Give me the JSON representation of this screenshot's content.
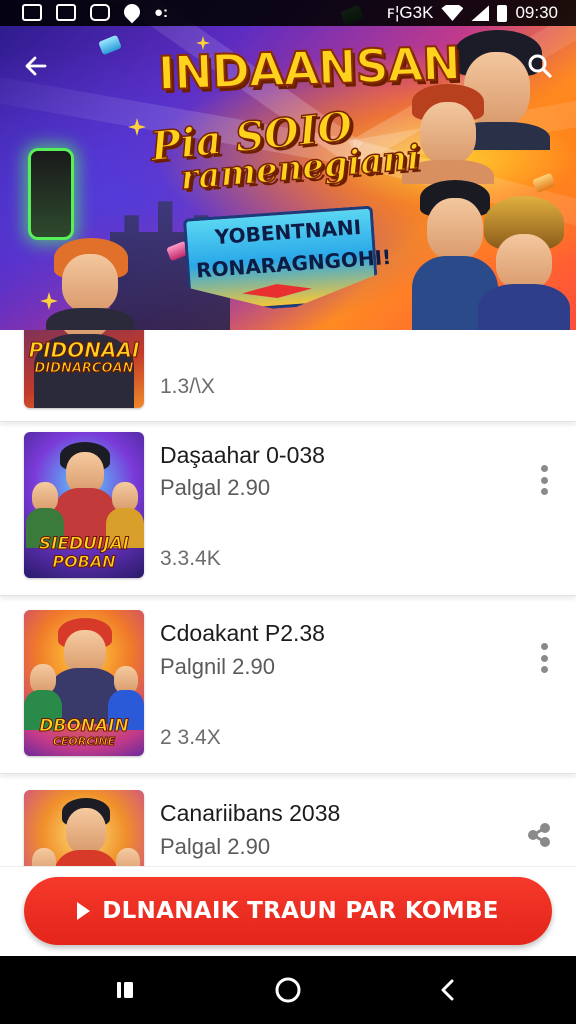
{
  "status_bar": {
    "right_text": "ꜰ¦G3K",
    "time": "09:30",
    "left_icons": [
      "image-icon",
      "gallery-icon",
      "camera-icon",
      "shield-icon",
      "more-notifications-icon"
    ]
  },
  "header": {
    "back_icon": "arrow-left-icon",
    "search_icon": "search-icon"
  },
  "banner": {
    "title_line1": "INDAANSAN",
    "title_line2": "Pia SOIO",
    "title_line3": "ramenegiani",
    "ribbon_line1": "YOBENTNANI",
    "ribbon_line2": "RONARAGNGOHI!"
  },
  "list": {
    "items": [
      {
        "title": "",
        "subtitle": "",
        "count": "1.3/\\X",
        "thumb_label_1": "PIDONAAI",
        "thumb_label_2": "DIDNARCOAN",
        "action_icon": ""
      },
      {
        "title": "Daşaahar 0-038",
        "subtitle": "Palgal 2.90",
        "count": "3.3.4K",
        "thumb_label_1": "SIEDUIJAI",
        "thumb_label_2": "POBAN",
        "action_icon": "more-vertical-icon"
      },
      {
        "title": "Cdoakant P2.38",
        "subtitle": "Palgnil 2.90",
        "count": "2 3.4X",
        "thumb_label_1": "DBONAIN",
        "thumb_label_2": "CEORCINE",
        "action_icon": "more-vertical-icon"
      },
      {
        "title": "Canariibans 2038",
        "subtitle": "Palgal 2.90",
        "count": "",
        "thumb_label_1": "",
        "thumb_label_2": "",
        "action_icon": "share-icon"
      }
    ]
  },
  "cta": {
    "label": "DLNANAIK TRAUN PAR KOMBE",
    "icon": "play-icon",
    "color": "#EE2E22"
  },
  "nav_bar": {
    "back": "nav-back-icon",
    "home": "nav-home-icon",
    "recents": "nav-recents-icon"
  },
  "colors": {
    "accent": "#EE2E22",
    "title_yellow": "#FFD21E",
    "divider": "#E4E4E4"
  }
}
